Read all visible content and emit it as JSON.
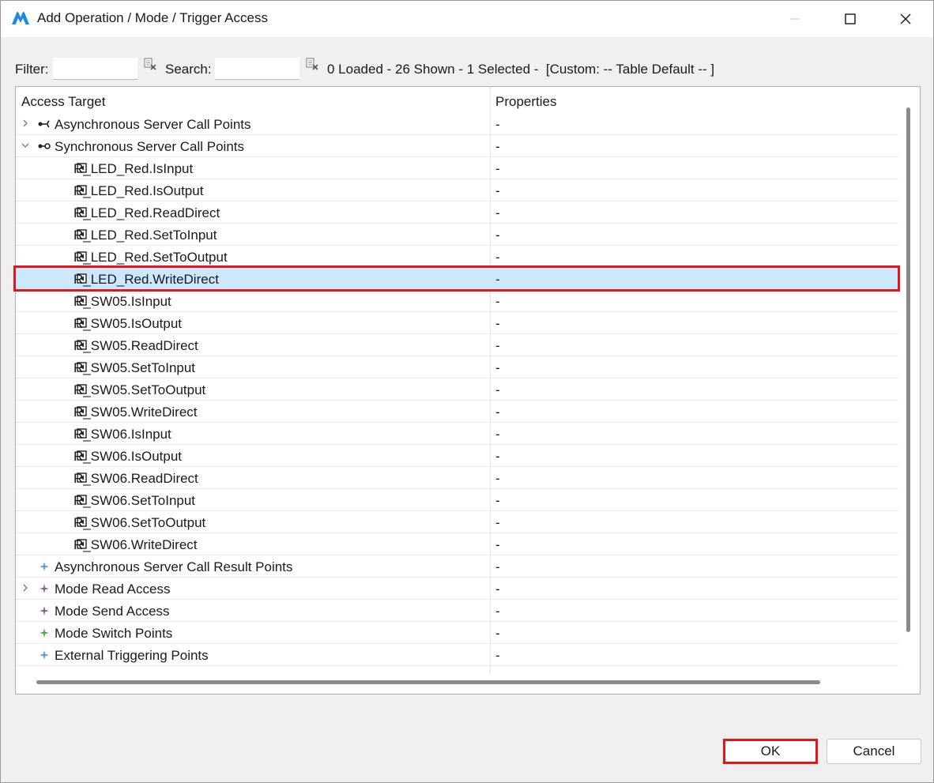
{
  "window": {
    "title": "Add Operation / Mode / Trigger Access",
    "brand_color": "#1e88e5"
  },
  "filterbar": {
    "filter_label": "Filter:",
    "filter_value": "",
    "search_label": "Search:",
    "search_value": "",
    "status": "0 Loaded - 26 Shown - 1 Selected -  [Custom: -- Table Default -- ]"
  },
  "table": {
    "columns": [
      "Access Target",
      "Properties"
    ],
    "rows": [
      {
        "label": "Asynchronous Server Call Points",
        "prop": "-",
        "level": 0,
        "expander": "collapsed",
        "icon": "async-call-icon",
        "selected": false
      },
      {
        "label": "Synchronous Server Call Points",
        "prop": "-",
        "level": 0,
        "expander": "expanded",
        "icon": "sync-call-icon",
        "selected": false
      },
      {
        "label": "R_LED_Red.IsInput",
        "prop": "-",
        "level": 1,
        "expander": "none",
        "icon": "port-op-icon",
        "selected": false
      },
      {
        "label": "R_LED_Red.IsOutput",
        "prop": "-",
        "level": 1,
        "expander": "none",
        "icon": "port-op-icon",
        "selected": false
      },
      {
        "label": "R_LED_Red.ReadDirect",
        "prop": "-",
        "level": 1,
        "expander": "none",
        "icon": "port-op-icon",
        "selected": false
      },
      {
        "label": "R_LED_Red.SetToInput",
        "prop": "-",
        "level": 1,
        "expander": "none",
        "icon": "port-op-icon",
        "selected": false
      },
      {
        "label": "R_LED_Red.SetToOutput",
        "prop": "-",
        "level": 1,
        "expander": "none",
        "icon": "port-op-icon",
        "selected": false
      },
      {
        "label": "R_LED_Red.WriteDirect",
        "prop": "-",
        "level": 1,
        "expander": "none",
        "icon": "port-op-icon",
        "selected": true
      },
      {
        "label": "R_SW05.IsInput",
        "prop": "-",
        "level": 1,
        "expander": "none",
        "icon": "port-op-icon",
        "selected": false
      },
      {
        "label": "R_SW05.IsOutput",
        "prop": "-",
        "level": 1,
        "expander": "none",
        "icon": "port-op-icon",
        "selected": false
      },
      {
        "label": "R_SW05.ReadDirect",
        "prop": "-",
        "level": 1,
        "expander": "none",
        "icon": "port-op-icon",
        "selected": false
      },
      {
        "label": "R_SW05.SetToInput",
        "prop": "-",
        "level": 1,
        "expander": "none",
        "icon": "port-op-icon",
        "selected": false
      },
      {
        "label": "R_SW05.SetToOutput",
        "prop": "-",
        "level": 1,
        "expander": "none",
        "icon": "port-op-icon",
        "selected": false
      },
      {
        "label": "R_SW05.WriteDirect",
        "prop": "-",
        "level": 1,
        "expander": "none",
        "icon": "port-op-icon",
        "selected": false
      },
      {
        "label": "R_SW06.IsInput",
        "prop": "-",
        "level": 1,
        "expander": "none",
        "icon": "port-op-icon",
        "selected": false
      },
      {
        "label": "R_SW06.IsOutput",
        "prop": "-",
        "level": 1,
        "expander": "none",
        "icon": "port-op-icon",
        "selected": false
      },
      {
        "label": "R_SW06.ReadDirect",
        "prop": "-",
        "level": 1,
        "expander": "none",
        "icon": "port-op-icon",
        "selected": false
      },
      {
        "label": "R_SW06.SetToInput",
        "prop": "-",
        "level": 1,
        "expander": "none",
        "icon": "port-op-icon",
        "selected": false
      },
      {
        "label": "R_SW06.SetToOutput",
        "prop": "-",
        "level": 1,
        "expander": "none",
        "icon": "port-op-icon",
        "selected": false
      },
      {
        "label": "R_SW06.WriteDirect",
        "prop": "-",
        "level": 1,
        "expander": "none",
        "icon": "port-op-icon",
        "selected": false
      },
      {
        "label": "Asynchronous Server Call Result Points",
        "prop": "-",
        "level": 0,
        "expander": "none",
        "icon": "result-point-icon",
        "selected": false,
        "icon_color": "#5b9bd5"
      },
      {
        "label": "Mode Read Access",
        "prop": "-",
        "level": 0,
        "expander": "collapsed",
        "icon": "mode-read-icon",
        "selected": false,
        "icon_color": "#8e5ba3"
      },
      {
        "label": "Mode Send Access",
        "prop": "-",
        "level": 0,
        "expander": "none",
        "icon": "mode-send-icon",
        "selected": false,
        "icon_color": "#8e5ba3"
      },
      {
        "label": "Mode Switch Points",
        "prop": "-",
        "level": 0,
        "expander": "none",
        "icon": "mode-switch-icon",
        "selected": false,
        "icon_color": "#4caf50"
      },
      {
        "label": "External Triggering Points",
        "prop": "-",
        "level": 0,
        "expander": "none",
        "icon": "trigger-point-icon",
        "selected": false,
        "icon_color": "#5b9bd5"
      }
    ]
  },
  "buttons": {
    "ok": "OK",
    "cancel": "Cancel"
  },
  "highlight_color": "#e3161b",
  "selection_color": "#cce8ff"
}
